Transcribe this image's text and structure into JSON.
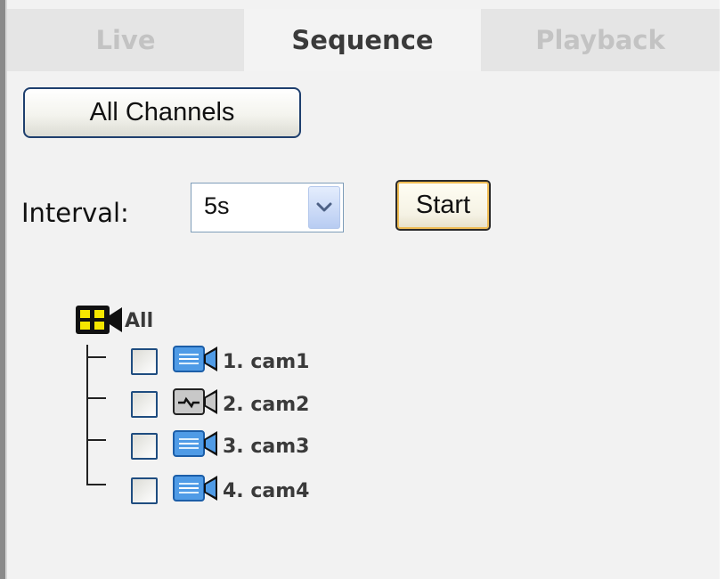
{
  "tabs": [
    {
      "label": "Live",
      "active": false
    },
    {
      "label": "Sequence",
      "active": true
    },
    {
      "label": "Playback",
      "active": false
    }
  ],
  "all_channels_button": "All Channels",
  "interval": {
    "label": "Interval:",
    "selected": "5s"
  },
  "start_button": "Start",
  "tree": {
    "root_label": "All",
    "root_icon": "camera-group-icon",
    "cameras": [
      {
        "label": "1. cam1",
        "icon": "camera-online-icon",
        "checked": false
      },
      {
        "label": "2. cam2",
        "icon": "camera-offline-icon",
        "checked": false
      },
      {
        "label": "3. cam3",
        "icon": "camera-online-icon",
        "checked": false
      },
      {
        "label": "4. cam4",
        "icon": "camera-online-icon",
        "checked": false
      }
    ]
  },
  "colors": {
    "camera_online": "#4f9be6",
    "camera_offline": "#c8c8c8",
    "group_icon": "#f5e600",
    "tab_active_text": "#3a3a3a",
    "tab_inactive_text": "#c3c3c3"
  }
}
